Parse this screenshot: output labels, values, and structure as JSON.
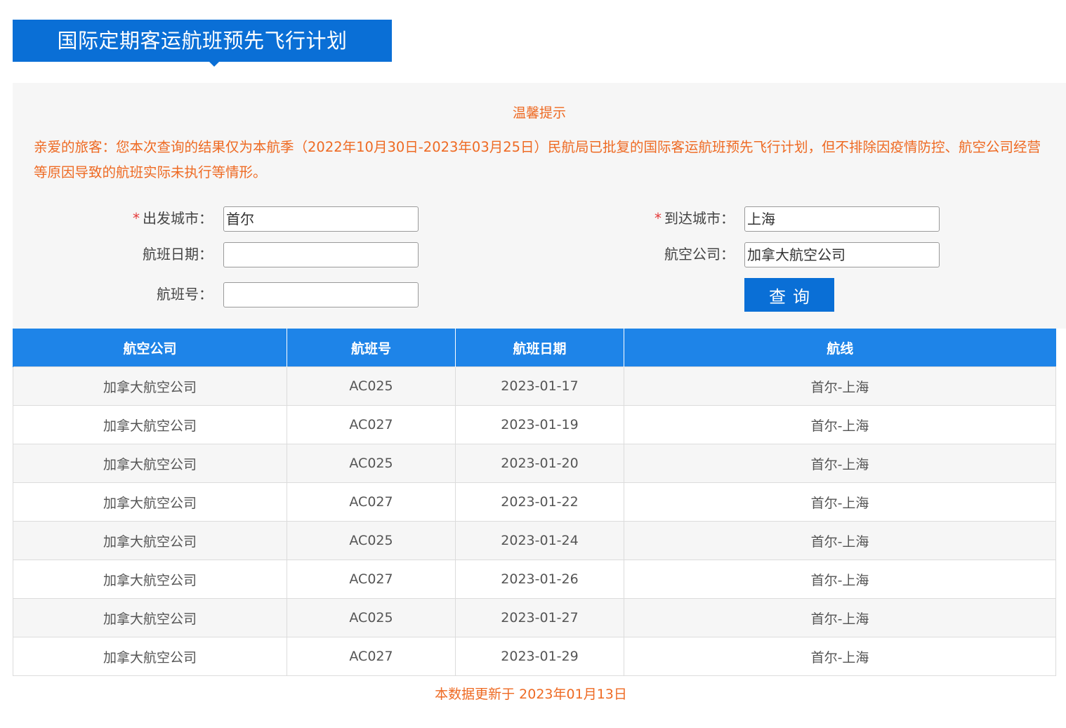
{
  "page": {
    "title": "国际定期客运航班预先飞行计划"
  },
  "notice": {
    "title": "温馨提示",
    "text": "亲爱的旅客：您本次查询的结果仅为本航季（2022年10月30日-2023年03月25日）民航局已批复的国际客运航班预先飞行计划，但不排除因疫情防控、航空公司经营等原因导致的航班实际未执行等情形。"
  },
  "form": {
    "required_mark": "*",
    "departure_label": "出发城市：",
    "departure_value": "首尔",
    "arrival_label": "到达城市：",
    "arrival_value": "上海",
    "date_label": "航班日期：",
    "date_value": "",
    "airline_label": "航空公司：",
    "airline_value": "加拿大航空公司",
    "flight_no_label": "航班号：",
    "flight_no_value": "",
    "query_button": "查询"
  },
  "table": {
    "headers": [
      "航空公司",
      "航班号",
      "航班日期",
      "航线"
    ],
    "rows": [
      [
        "加拿大航空公司",
        "AC025",
        "2023-01-17",
        "首尔-上海"
      ],
      [
        "加拿大航空公司",
        "AC027",
        "2023-01-19",
        "首尔-上海"
      ],
      [
        "加拿大航空公司",
        "AC025",
        "2023-01-20",
        "首尔-上海"
      ],
      [
        "加拿大航空公司",
        "AC027",
        "2023-01-22",
        "首尔-上海"
      ],
      [
        "加拿大航空公司",
        "AC025",
        "2023-01-24",
        "首尔-上海"
      ],
      [
        "加拿大航空公司",
        "AC027",
        "2023-01-26",
        "首尔-上海"
      ],
      [
        "加拿大航空公司",
        "AC025",
        "2023-01-27",
        "首尔-上海"
      ],
      [
        "加拿大航空公司",
        "AC027",
        "2023-01-29",
        "首尔-上海"
      ]
    ]
  },
  "footer": {
    "text": "本数据更新于 2023年01月13日"
  },
  "colors": {
    "brand_blue": "#0a6fd6",
    "header_blue": "#1e84e8",
    "notice_orange": "#ee6a23",
    "required_red": "#e43a3a"
  }
}
